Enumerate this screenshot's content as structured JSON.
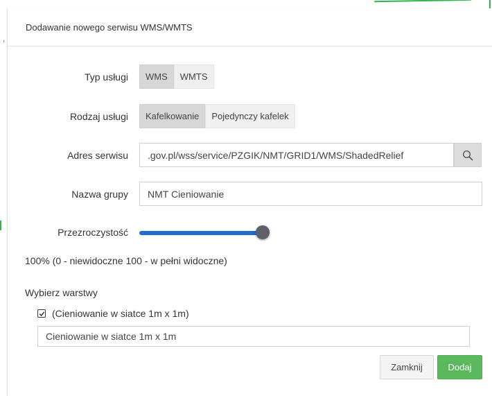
{
  "dialog": {
    "title": "Dodawanie nowego serwisu WMS/WMTS"
  },
  "service_type": {
    "label": "Typ usługi",
    "options": [
      "WMS",
      "WMTS"
    ],
    "selected": "WMS"
  },
  "service_kind": {
    "label": "Rodzaj usługi",
    "options": [
      "Kafelkowanie",
      "Pojedynczy kafelek"
    ],
    "selected": "Kafelkowanie"
  },
  "service_address": {
    "label": "Adres serwisu",
    "value": ".gov.pl/wss/service/PZGIK/NMT/GRID1/WMS/ShadedRelief",
    "search_icon": "search-icon"
  },
  "group_name": {
    "label": "Nazwa grupy",
    "value": "NMT Cieniowanie"
  },
  "opacity": {
    "label": "Przezroczystość",
    "value": 100,
    "hint": "100% (0 - niewidoczne 100 - w pełni widoczne)"
  },
  "layers": {
    "heading": "Wybierz warstwy",
    "items": [
      {
        "label": "(Cieniowanie w siatce 1m x 1m)",
        "checked": true
      }
    ],
    "name_value": "Cieniowanie w siatce 1m x 1m"
  },
  "footer": {
    "close_label": "Zamknij",
    "add_label": "Dodaj"
  },
  "colors": {
    "accent": "#1e6fd1",
    "add_button": "#5cb85c",
    "selected_segment": "#d7d7d7",
    "background_lines": "#2fb34a"
  }
}
